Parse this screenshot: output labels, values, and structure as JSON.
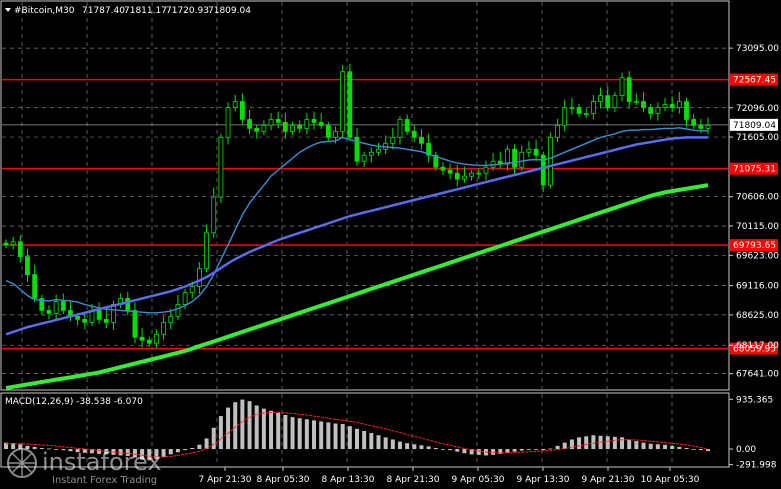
{
  "header": {
    "symbol": "#Bitcoin,M30",
    "open": "71787.40",
    "high": "71811.17",
    "low": "71720.93",
    "close": "71809.04"
  },
  "macd_header": "MACD(12,26,9) -38.538 -6.070",
  "watermark": {
    "brand": "instaforex",
    "tagline": "Instant Forex Trading"
  },
  "chart_data": [
    {
      "type": "candlestick",
      "title": "#Bitcoin,M30",
      "ylim": [
        67400,
        73600
      ],
      "price_ticks": [
        "73095.00",
        "72096.00",
        "71605.00",
        "70606.00",
        "70115.00",
        "69623.00",
        "69116.00",
        "68625.00",
        "68117.00",
        "67641.00"
      ],
      "x_ticks": [
        "7 Apr 21:30",
        "8 Apr 05:30",
        "8 Apr 13:30",
        "8 Apr 21:30",
        "9 Apr 05:30",
        "9 Apr 13:30",
        "9 Apr 21:30",
        "10 Apr 05:30"
      ],
      "horizontal_levels": [
        {
          "label": "72567.45",
          "value": 72567.45,
          "color": "#ff0000"
        },
        {
          "label": "71075.31",
          "value": 71075.31,
          "color": "#ff0000"
        },
        {
          "label": "69793.65",
          "value": 69793.65,
          "color": "#ff0000"
        },
        {
          "label": "68059.95",
          "value": 68059.95,
          "color": "#ff0000"
        }
      ],
      "current_price": {
        "label": "71809.04",
        "value": 71809.04
      },
      "close_series": [
        69800,
        69850,
        69600,
        69300,
        68900,
        68700,
        68650,
        68850,
        68700,
        68600,
        68550,
        68500,
        68700,
        68550,
        68500,
        68800,
        68900,
        68700,
        68250,
        68200,
        68150,
        68300,
        68500,
        68600,
        68800,
        69000,
        69100,
        69400,
        70000,
        70600,
        71600,
        72100,
        72200,
        71900,
        71750,
        71700,
        71800,
        71900,
        71850,
        71700,
        71800,
        71750,
        71900,
        71850,
        71800,
        71600,
        71700,
        72700,
        71600,
        71200,
        71300,
        71350,
        71400,
        71500,
        71600,
        71900,
        71700,
        71600,
        71500,
        71300,
        71100,
        71050,
        71000,
        70900,
        70950,
        71000,
        71000,
        71100,
        71200,
        71150,
        71400,
        71100,
        71350,
        71400,
        71300,
        70800,
        71600,
        71800,
        72100,
        72100,
        72000,
        72000,
        72200,
        72300,
        72100,
        72300,
        72600,
        72200,
        72200,
        72100,
        72000,
        72100,
        72150,
        72100,
        72200,
        71900,
        71800,
        71750,
        71800
      ],
      "series": [
        {
          "name": "",
          "color": "#3a8fd6",
          "values": [
            69200,
            69150,
            69050,
            68950,
            68880,
            68870,
            68860,
            68880,
            68870,
            68860,
            68840,
            68800,
            68770,
            68740,
            68720,
            68710,
            68700,
            68690,
            68680,
            68670,
            68660,
            68660,
            68670,
            68690,
            68730,
            68780,
            68850,
            68950,
            69100,
            69300,
            69550,
            69800,
            70050,
            70300,
            70500,
            70650,
            70800,
            70950,
            71050,
            71150,
            71250,
            71350,
            71420,
            71480,
            71520,
            71530,
            71540,
            71600,
            71560,
            71530,
            71500,
            71470,
            71450,
            71440,
            71430,
            71420,
            71400,
            71380,
            71360,
            71320,
            71280,
            71240,
            71200,
            71170,
            71150,
            71140,
            71130,
            71130,
            71140,
            71150,
            71170,
            71180,
            71200,
            71220,
            71230,
            71220,
            71250,
            71300,
            71350,
            71400,
            71450,
            71500,
            71550,
            71600,
            71630,
            71660,
            71700,
            71720,
            71720,
            71730,
            71730,
            71740,
            71750,
            71750,
            71760,
            71740,
            71720,
            71710,
            71710
          ]
        },
        {
          "name": "",
          "color": "#5a6cf0",
          "values": [
            68300,
            68340,
            68380,
            68420,
            68450,
            68480,
            68510,
            68540,
            68570,
            68600,
            68630,
            68660,
            68690,
            68720,
            68750,
            68780,
            68810,
            68840,
            68870,
            68900,
            68930,
            68960,
            68990,
            69020,
            69060,
            69100,
            69150,
            69200,
            69260,
            69330,
            69410,
            69490,
            69560,
            69620,
            69680,
            69730,
            69780,
            69830,
            69880,
            69920,
            69960,
            70000,
            70040,
            70080,
            70120,
            70160,
            70200,
            70240,
            70280,
            70310,
            70340,
            70370,
            70400,
            70430,
            70460,
            70490,
            70520,
            70550,
            70580,
            70610,
            70640,
            70670,
            70700,
            70730,
            70760,
            70790,
            70820,
            70850,
            70880,
            70910,
            70940,
            70970,
            71000,
            71030,
            71060,
            71090,
            71120,
            71150,
            71180,
            71210,
            71240,
            71270,
            71300,
            71330,
            71360,
            71390,
            71420,
            71450,
            71480,
            71500,
            71520,
            71540,
            71560,
            71580,
            71590,
            71600,
            71600,
            71600,
            71600
          ]
        },
        {
          "name": "",
          "color": "#33ee33",
          "values": [
            67400,
            67420,
            67440,
            67460,
            67480,
            67500,
            67520,
            67540,
            67560,
            67580,
            67600,
            67620,
            67640,
            67660,
            67690,
            67720,
            67750,
            67780,
            67810,
            67840,
            67870,
            67900,
            67930,
            67960,
            67990,
            68020,
            68060,
            68100,
            68140,
            68180,
            68220,
            68260,
            68300,
            68340,
            68380,
            68420,
            68460,
            68500,
            68540,
            68580,
            68620,
            68660,
            68700,
            68740,
            68780,
            68820,
            68860,
            68900,
            68940,
            68980,
            69020,
            69060,
            69100,
            69140,
            69180,
            69220,
            69260,
            69300,
            69340,
            69380,
            69420,
            69460,
            69500,
            69540,
            69580,
            69620,
            69660,
            69700,
            69740,
            69780,
            69820,
            69860,
            69900,
            69940,
            69980,
            70020,
            70060,
            70100,
            70140,
            70180,
            70220,
            70260,
            70300,
            70340,
            70380,
            70420,
            70460,
            70500,
            70540,
            70580,
            70620,
            70650,
            70680,
            70700,
            70720,
            70740,
            70760,
            70780,
            70800
          ]
        }
      ]
    },
    {
      "type": "bar",
      "title": "MACD(12,26,9) -38.538 -6.070",
      "ylim": [
        -300,
        960
      ],
      "y_ticks": [
        "935.365",
        "0.00",
        "-291.998"
      ],
      "values": [
        120,
        110,
        90,
        60,
        40,
        20,
        10,
        0,
        -20,
        -40,
        -60,
        -70,
        -80,
        -90,
        -100,
        -110,
        -120,
        -130,
        -160,
        -200,
        -210,
        -190,
        -150,
        -100,
        -60,
        -20,
        20,
        80,
        200,
        400,
        620,
        780,
        880,
        930,
        900,
        820,
        760,
        720,
        680,
        640,
        600,
        580,
        560,
        540,
        520,
        500,
        480,
        470,
        430,
        380,
        340,
        300,
        260,
        220,
        180,
        140,
        110,
        90,
        70,
        50,
        20,
        0,
        -20,
        -50,
        -80,
        -100,
        -110,
        -120,
        -110,
        -90,
        -70,
        -50,
        -30,
        -10,
        0,
        -20,
        10,
        60,
        120,
        180,
        220,
        240,
        260,
        250,
        240,
        230,
        220,
        180,
        150,
        120,
        100,
        90,
        80,
        60,
        40,
        20,
        0,
        -20,
        -38.5
      ],
      "signal": [
        100,
        100,
        98,
        92,
        85,
        76,
        66,
        57,
        45,
        30,
        15,
        0,
        -15,
        -30,
        -45,
        -58,
        -70,
        -82,
        -96,
        -115,
        -135,
        -148,
        -150,
        -140,
        -120,
        -96,
        -72,
        -40,
        10,
        90,
        190,
        300,
        410,
        520,
        600,
        650,
        680,
        690,
        690,
        680,
        670,
        655,
        640,
        620,
        600,
        580,
        560,
        545,
        525,
        500,
        470,
        440,
        410,
        380,
        345,
        310,
        275,
        240,
        205,
        170,
        135,
        100,
        70,
        40,
        10,
        -15,
        -35,
        -55,
        -65,
        -70,
        -70,
        -66,
        -60,
        -52,
        -42,
        -35,
        -25,
        -10,
        10,
        35,
        60,
        85,
        110,
        130,
        150,
        165,
        175,
        175,
        170,
        160,
        148,
        135,
        122,
        108,
        92,
        75,
        55,
        30,
        -6.07
      ]
    }
  ]
}
